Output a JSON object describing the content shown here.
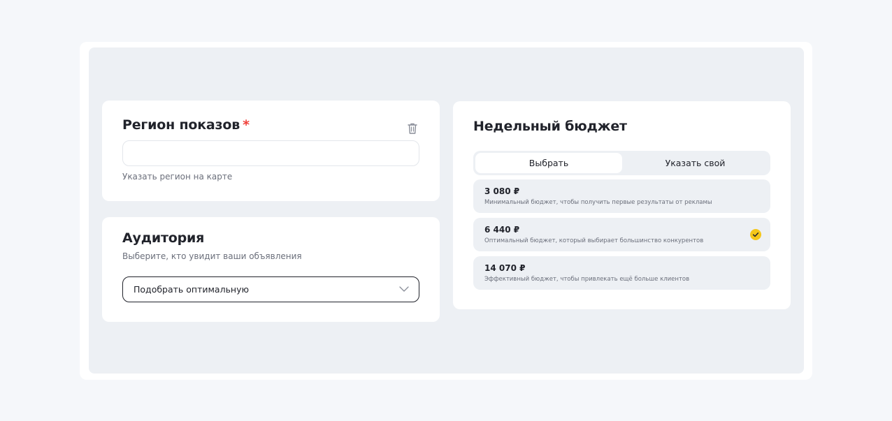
{
  "region": {
    "title": "Регион показов",
    "required_mark": "*",
    "input_value": "",
    "input_placeholder": "",
    "map_link": "Указать регион на карте"
  },
  "audience": {
    "title": "Аудитория",
    "subtitle": "Выберите, кто увидит ваши объявления",
    "selected": "Подобрать оптимальную"
  },
  "budget": {
    "title": "Недельный бюджет",
    "tabs": [
      "Выбрать",
      "Указать свой"
    ],
    "active_tab": "Выбрать",
    "options": [
      {
        "price": "3 080 ₽",
        "description": "Минимальный бюджет, чтобы получить первые результаты от рекламы",
        "selected": false
      },
      {
        "price": "6 440 ₽",
        "description": "Оптимальный бюджет, который выбирает большинство конкурентов",
        "selected": true
      },
      {
        "price": "14 070 ₽",
        "description": "Эффективный бюджет, чтобы привлекать ещё больше клиентов",
        "selected": false
      }
    ]
  },
  "colors": {
    "accent_check": "#f5c71a",
    "required": "#f0403a",
    "panel_bg": "#edf0f4"
  }
}
